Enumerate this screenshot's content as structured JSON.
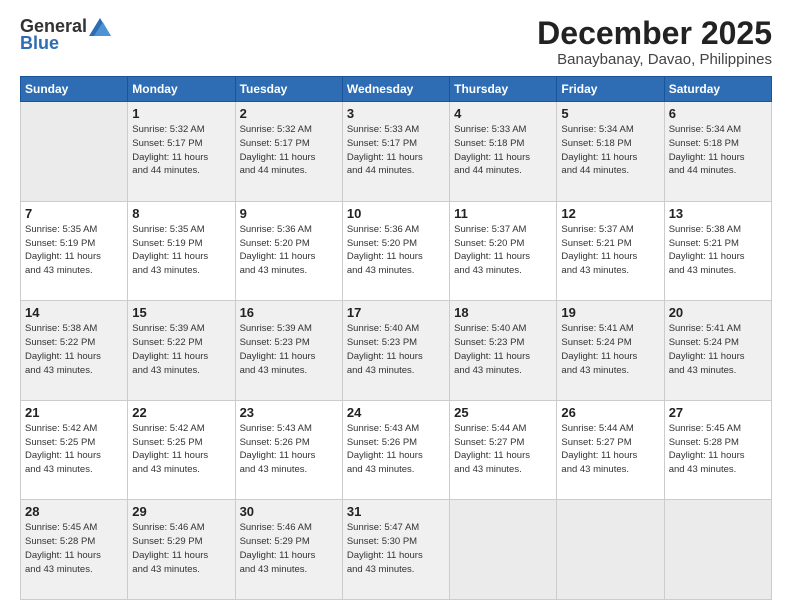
{
  "logo": {
    "general": "General",
    "blue": "Blue"
  },
  "header": {
    "month": "December 2025",
    "location": "Banaybanay, Davao, Philippines"
  },
  "weekdays": [
    "Sunday",
    "Monday",
    "Tuesday",
    "Wednesday",
    "Thursday",
    "Friday",
    "Saturday"
  ],
  "weeks": [
    [
      {
        "day": "",
        "info": ""
      },
      {
        "day": "1",
        "info": "Sunrise: 5:32 AM\nSunset: 5:17 PM\nDaylight: 11 hours\nand 44 minutes."
      },
      {
        "day": "2",
        "info": "Sunrise: 5:32 AM\nSunset: 5:17 PM\nDaylight: 11 hours\nand 44 minutes."
      },
      {
        "day": "3",
        "info": "Sunrise: 5:33 AM\nSunset: 5:17 PM\nDaylight: 11 hours\nand 44 minutes."
      },
      {
        "day": "4",
        "info": "Sunrise: 5:33 AM\nSunset: 5:18 PM\nDaylight: 11 hours\nand 44 minutes."
      },
      {
        "day": "5",
        "info": "Sunrise: 5:34 AM\nSunset: 5:18 PM\nDaylight: 11 hours\nand 44 minutes."
      },
      {
        "day": "6",
        "info": "Sunrise: 5:34 AM\nSunset: 5:18 PM\nDaylight: 11 hours\nand 44 minutes."
      }
    ],
    [
      {
        "day": "7",
        "info": "Sunrise: 5:35 AM\nSunset: 5:19 PM\nDaylight: 11 hours\nand 43 minutes."
      },
      {
        "day": "8",
        "info": "Sunrise: 5:35 AM\nSunset: 5:19 PM\nDaylight: 11 hours\nand 43 minutes."
      },
      {
        "day": "9",
        "info": "Sunrise: 5:36 AM\nSunset: 5:20 PM\nDaylight: 11 hours\nand 43 minutes."
      },
      {
        "day": "10",
        "info": "Sunrise: 5:36 AM\nSunset: 5:20 PM\nDaylight: 11 hours\nand 43 minutes."
      },
      {
        "day": "11",
        "info": "Sunrise: 5:37 AM\nSunset: 5:20 PM\nDaylight: 11 hours\nand 43 minutes."
      },
      {
        "day": "12",
        "info": "Sunrise: 5:37 AM\nSunset: 5:21 PM\nDaylight: 11 hours\nand 43 minutes."
      },
      {
        "day": "13",
        "info": "Sunrise: 5:38 AM\nSunset: 5:21 PM\nDaylight: 11 hours\nand 43 minutes."
      }
    ],
    [
      {
        "day": "14",
        "info": "Sunrise: 5:38 AM\nSunset: 5:22 PM\nDaylight: 11 hours\nand 43 minutes."
      },
      {
        "day": "15",
        "info": "Sunrise: 5:39 AM\nSunset: 5:22 PM\nDaylight: 11 hours\nand 43 minutes."
      },
      {
        "day": "16",
        "info": "Sunrise: 5:39 AM\nSunset: 5:23 PM\nDaylight: 11 hours\nand 43 minutes."
      },
      {
        "day": "17",
        "info": "Sunrise: 5:40 AM\nSunset: 5:23 PM\nDaylight: 11 hours\nand 43 minutes."
      },
      {
        "day": "18",
        "info": "Sunrise: 5:40 AM\nSunset: 5:23 PM\nDaylight: 11 hours\nand 43 minutes."
      },
      {
        "day": "19",
        "info": "Sunrise: 5:41 AM\nSunset: 5:24 PM\nDaylight: 11 hours\nand 43 minutes."
      },
      {
        "day": "20",
        "info": "Sunrise: 5:41 AM\nSunset: 5:24 PM\nDaylight: 11 hours\nand 43 minutes."
      }
    ],
    [
      {
        "day": "21",
        "info": "Sunrise: 5:42 AM\nSunset: 5:25 PM\nDaylight: 11 hours\nand 43 minutes."
      },
      {
        "day": "22",
        "info": "Sunrise: 5:42 AM\nSunset: 5:25 PM\nDaylight: 11 hours\nand 43 minutes."
      },
      {
        "day": "23",
        "info": "Sunrise: 5:43 AM\nSunset: 5:26 PM\nDaylight: 11 hours\nand 43 minutes."
      },
      {
        "day": "24",
        "info": "Sunrise: 5:43 AM\nSunset: 5:26 PM\nDaylight: 11 hours\nand 43 minutes."
      },
      {
        "day": "25",
        "info": "Sunrise: 5:44 AM\nSunset: 5:27 PM\nDaylight: 11 hours\nand 43 minutes."
      },
      {
        "day": "26",
        "info": "Sunrise: 5:44 AM\nSunset: 5:27 PM\nDaylight: 11 hours\nand 43 minutes."
      },
      {
        "day": "27",
        "info": "Sunrise: 5:45 AM\nSunset: 5:28 PM\nDaylight: 11 hours\nand 43 minutes."
      }
    ],
    [
      {
        "day": "28",
        "info": "Sunrise: 5:45 AM\nSunset: 5:28 PM\nDaylight: 11 hours\nand 43 minutes."
      },
      {
        "day": "29",
        "info": "Sunrise: 5:46 AM\nSunset: 5:29 PM\nDaylight: 11 hours\nand 43 minutes."
      },
      {
        "day": "30",
        "info": "Sunrise: 5:46 AM\nSunset: 5:29 PM\nDaylight: 11 hours\nand 43 minutes."
      },
      {
        "day": "31",
        "info": "Sunrise: 5:47 AM\nSunset: 5:30 PM\nDaylight: 11 hours\nand 43 minutes."
      },
      {
        "day": "",
        "info": ""
      },
      {
        "day": "",
        "info": ""
      },
      {
        "day": "",
        "info": ""
      }
    ]
  ]
}
